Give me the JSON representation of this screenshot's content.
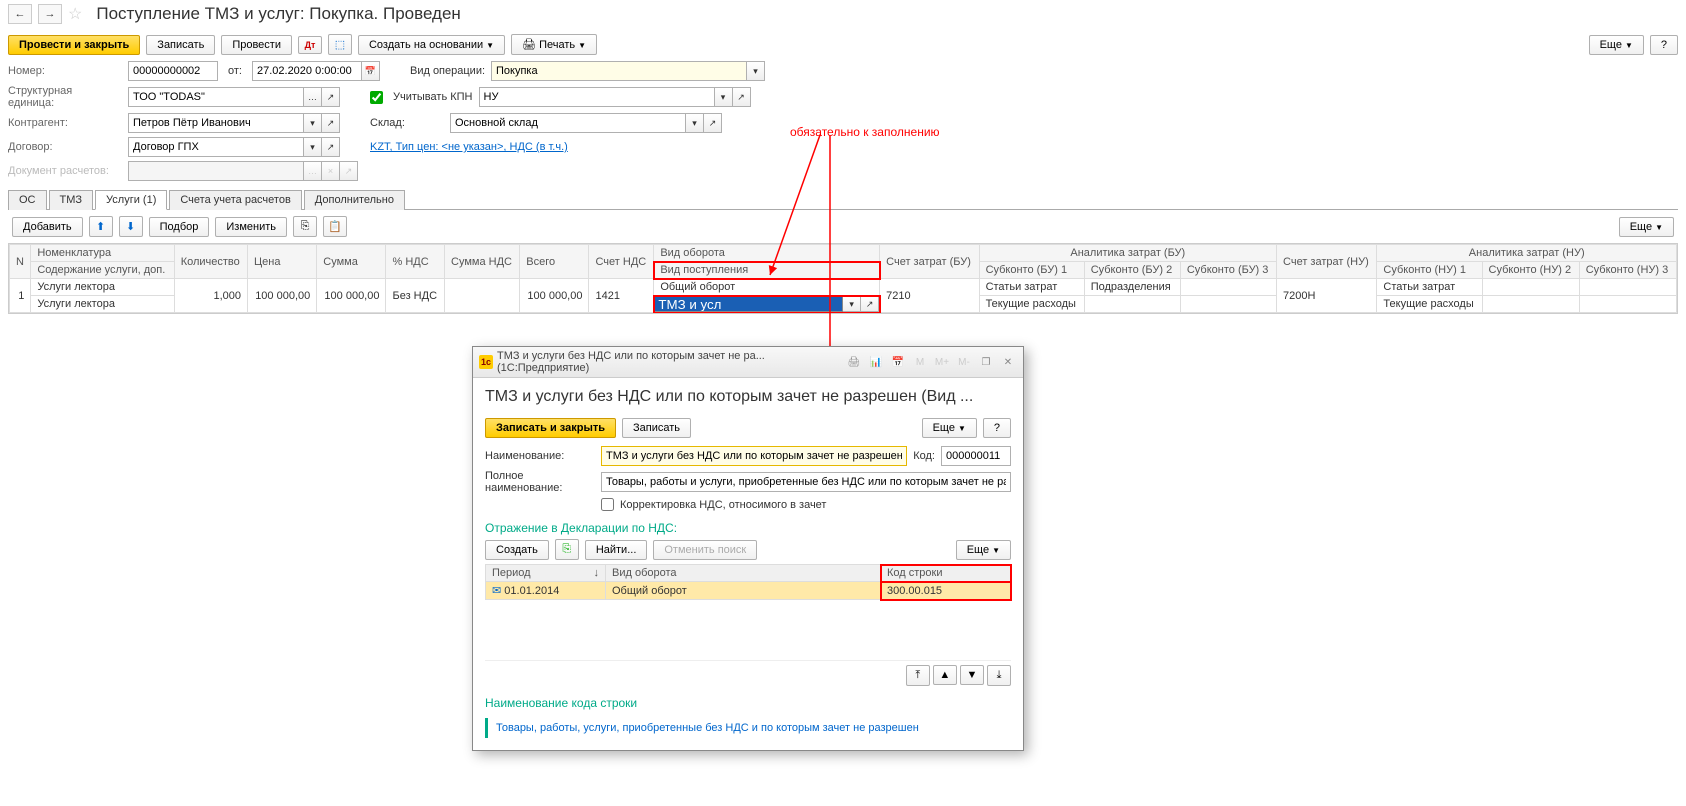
{
  "header": {
    "title": "Поступление ТМЗ и услуг: Покупка. Проведен"
  },
  "toolbar": {
    "post_close": "Провести и закрыть",
    "save": "Записать",
    "post": "Провести",
    "create_based": "Создать на основании",
    "print": "Печать",
    "more": "Еще",
    "help": "?"
  },
  "form": {
    "number_label": "Номер:",
    "number": "00000000002",
    "from_label": "от:",
    "date": "27.02.2020 0:00:00",
    "org_label": "Структурная единица:",
    "org": "ТОО \"TODAS\"",
    "counterparty_label": "Контрагент:",
    "counterparty": "Петров Пётр Иванович",
    "contract_label": "Договор:",
    "contract": "Договор ГПХ",
    "calc_doc_label": "Документ расчетов:",
    "calc_doc": "",
    "op_type_label": "Вид операции:",
    "op_type": "Покупка",
    "kpn_label": "Учитывать КПН",
    "kpn_val": "НУ",
    "warehouse_label": "Склад:",
    "warehouse": "Основной склад",
    "currency_link": "KZT, Тип цен: <не указан>, НДС (в т.ч.)"
  },
  "annotation": "обязательно к заполнению",
  "tabs": {
    "os": "ОС",
    "tmz": "ТМЗ",
    "services": "Услуги (1)",
    "accounts": "Счета учета расчетов",
    "extra": "Дополнительно"
  },
  "table_toolbar": {
    "add": "Добавить",
    "select": "Подбор",
    "change": "Изменить",
    "more": "Еще"
  },
  "table": {
    "headers": {
      "n": "N",
      "nomenclature": "Номенклатура",
      "nomenclature_sub": "Содержание услуги, доп.",
      "qty": "Количество",
      "price": "Цена",
      "sum": "Сумма",
      "vat_pct": "% НДС",
      "vat_sum": "Сумма НДС",
      "total": "Всего",
      "vat_acc": "Счет НДС",
      "turnover_type": "Вид оборота",
      "receipt_type": "Вид поступления",
      "cost_acc_bu": "Счет затрат (БУ)",
      "analytics_bu": "Аналитика затрат (БУ)",
      "sub1": "Субконто (БУ) 1",
      "sub2": "Субконто (БУ) 2",
      "sub3": "Субконто (БУ) 3",
      "cost_acc_nu": "Счет затрат (НУ)",
      "analytics_nu": "Аналитика затрат (НУ)",
      "nsub1": "Субконто (НУ) 1",
      "nsub2": "Субконто (НУ) 2",
      "nsub3": "Субконто (НУ) 3"
    },
    "row": {
      "n": "1",
      "nomenclature": "Услуги лектора",
      "nomenclature2": "Услуги лектора",
      "qty": "1,000",
      "price": "100 000,00",
      "sum": "100 000,00",
      "vat_pct": "Без НДС",
      "total": "100 000,00",
      "vat_acc": "1421",
      "turnover": "Общий оборот",
      "receipt_edit": "ТМЗ и усл",
      "cost_acc_bu": "7210",
      "sub1": "Статьи затрат",
      "sub1b": "Текущие расходы",
      "sub2": "Подразделения",
      "cost_acc_nu": "7200Н",
      "nsub1": "Статьи затрат",
      "nsub1b": "Текущие расходы"
    }
  },
  "modal": {
    "titlebar": "ТМЗ и услуги без НДС или по которым зачет не ра... (1С:Предприятие)",
    "header": "ТМЗ и услуги без НДС или по которым зачет не разрешен (Вид ...",
    "save_close": "Записать и закрыть",
    "save": "Записать",
    "more": "Еще",
    "help": "?",
    "name_label": "Наименование:",
    "name": "ТМЗ и услуги без НДС или по которым зачет не разрешен",
    "code_label": "Код:",
    "code": "000000011",
    "fullname_label": "Полное наименование:",
    "fullname": "Товары, работы и услуги, приобретенные без НДС или по которым зачет не разрешен",
    "corr_label": "Корректировка НДС, относимого в зачет",
    "section": "Отражение в Декларации по НДС:",
    "create": "Создать",
    "find": "Найти...",
    "cancel_find": "Отменить поиск",
    "th_period": "Период",
    "th_turnover": "Вид оборота",
    "th_code": "Код строки",
    "td_period": "01.01.2014",
    "td_turnover": "Общий оборот",
    "td_code": "300.00.015",
    "footer_title": "Наименование кода строки",
    "footer_text": "Товары, работы, услуги, приобретенные без НДС и по которым зачет не разрешен"
  }
}
